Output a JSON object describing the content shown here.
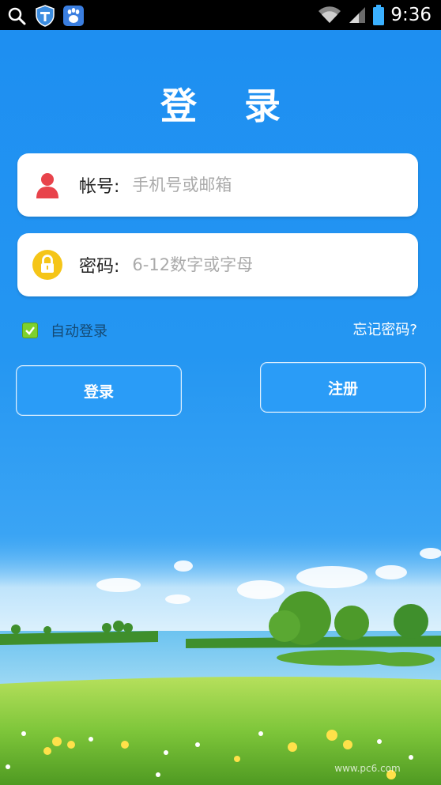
{
  "status_bar": {
    "time": "9:36",
    "left_icons": [
      "search-icon",
      "shield-app-icon",
      "baidu-paw-icon"
    ],
    "right_icons": [
      "wifi-icon",
      "signal-icon",
      "battery-icon"
    ]
  },
  "login": {
    "title": "登 录",
    "account": {
      "label": "帐号:",
      "placeholder": "手机号或邮箱",
      "icon": "user-icon",
      "icon_color": "#e8434b"
    },
    "password": {
      "label": "密码:",
      "placeholder": "6-12数字或字母",
      "icon": "lock-icon",
      "icon_color": "#f5c518"
    },
    "auto_login": {
      "label": "自动登录",
      "checked": true
    },
    "forgot_password": "忘记密码?",
    "login_button": "登录",
    "register_button": "注册"
  },
  "watermark": "www.pc6.com",
  "colors": {
    "background": "#1e8ff0",
    "checkbox": "#7ed12d",
    "button": "#2a9cf7"
  }
}
